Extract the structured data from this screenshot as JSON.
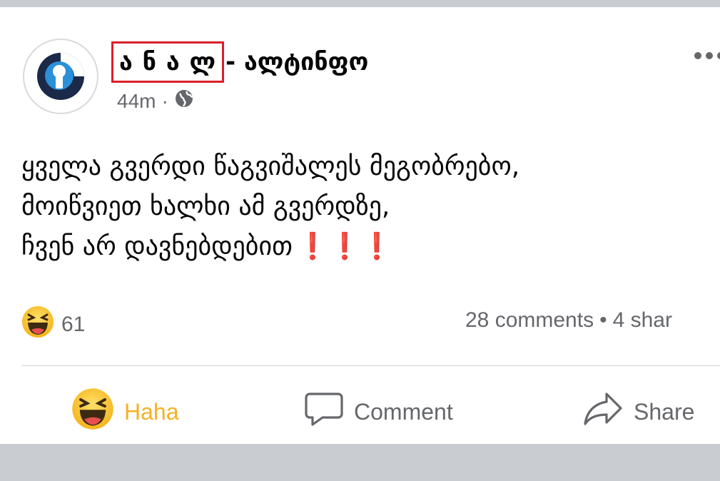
{
  "post": {
    "page_name_highlighted": "ა ნ ა ლ",
    "page_name_rest": "- ალტინფო",
    "time": "44m",
    "meta_separator": "·",
    "audience_icon": "globe-icon",
    "lines": [
      "ყველა გვერდი წაგვიშალეს მეგობრებო,",
      "მოიწვიეთ ხალხი ამ გვერდზე,",
      "ჩვენ არ დავნებდებით"
    ],
    "exclamations": "❗❗❗"
  },
  "reactions": {
    "icon": "haha-emoji-icon",
    "count": "61"
  },
  "stats": {
    "comments": "28 comments",
    "separator": "•",
    "shares": "4 shar"
  },
  "actions": {
    "haha_label": "Haha",
    "comment_label": "Comment",
    "share_label": "Share"
  },
  "colors": {
    "highlight_box": "#d9202a",
    "haha_active": "#f7b125",
    "secondary_text": "#65676b",
    "exclamation": "#e0242b"
  }
}
